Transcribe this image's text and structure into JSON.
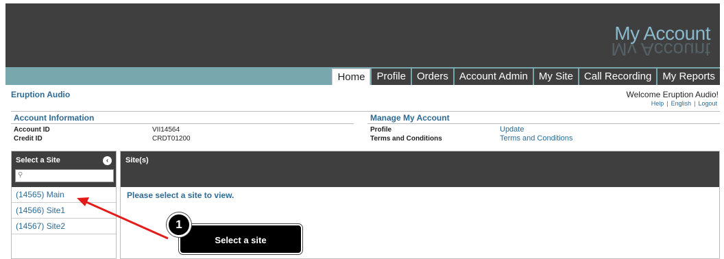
{
  "header": {
    "brand": "My Account"
  },
  "nav": {
    "tabs": [
      {
        "label": "Home"
      },
      {
        "label": "Profile"
      },
      {
        "label": "Orders"
      },
      {
        "label": "Account Admin"
      },
      {
        "label": "My Site"
      },
      {
        "label": "Call Recording"
      },
      {
        "label": "My Reports"
      }
    ]
  },
  "company_name": "Eruption Audio",
  "welcome_text": "Welcome Eruption Audio!",
  "top_links": {
    "help": "Help",
    "language": "English",
    "logout": "Logout"
  },
  "account_info": {
    "heading": "Account Information",
    "account_id_label": "Account ID",
    "account_id_value": "VII14564",
    "credit_id_label": "Credit ID",
    "credit_id_value": "CRDT01200"
  },
  "manage": {
    "heading": "Manage My Account",
    "profile_label": "Profile",
    "profile_link": "Update",
    "terms_label": "Terms and Conditions",
    "terms_link": "Terms and Conditions"
  },
  "sidebar": {
    "title": "Select a Site",
    "search_placeholder": "",
    "sites": [
      "(14565) Main",
      "(14566) Site1",
      "(14567) Site2"
    ]
  },
  "main": {
    "title": "Site(s)",
    "message": "Please select a site to view."
  },
  "annotation": {
    "step": "1",
    "text": "Select a site",
    "color": "#e31b1b"
  }
}
